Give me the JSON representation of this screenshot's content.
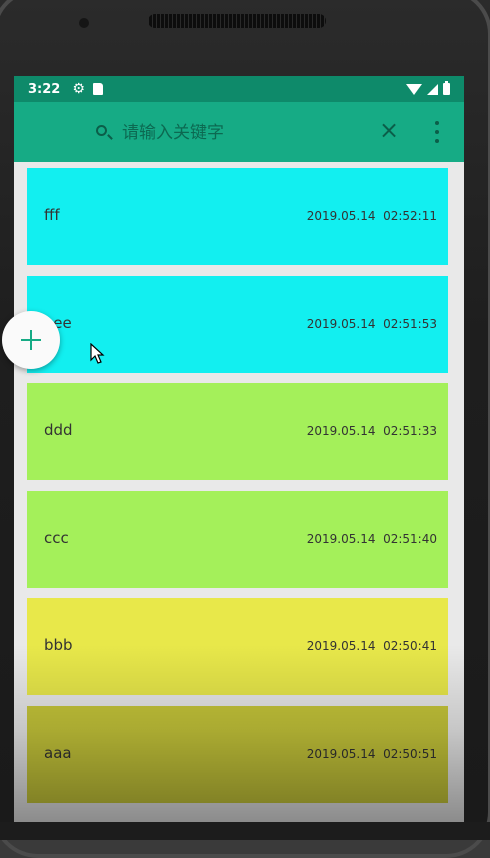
{
  "status_bar": {
    "time": "3:22",
    "icons": [
      "gear-icon",
      "sd-card-icon",
      "wifi-icon",
      "signal-icon",
      "battery-icon"
    ]
  },
  "toolbar": {
    "search_placeholder": "请输入关键字",
    "search_value": "",
    "close_symbol": "×",
    "background": "#16ab85"
  },
  "notes": [
    {
      "title": "fff",
      "time": "2019.05.14  02:52:11",
      "color": "#12eff0"
    },
    {
      "title": "eee",
      "time": "2019.05.14  02:51:53",
      "color": "#12eff0"
    },
    {
      "title": "ddd",
      "time": "2019.05.14  02:51:33",
      "color": "#a4f05a"
    },
    {
      "title": "ccc",
      "time": "2019.05.14  02:51:40",
      "color": "#a4f05a"
    },
    {
      "title": "bbb",
      "time": "2019.05.14  02:50:41",
      "color": "#e8e84a"
    },
    {
      "title": "aaa",
      "time": "2019.05.14  02:50:51",
      "color": "#c8c83a"
    }
  ],
  "fab": {
    "icon": "plus-icon"
  }
}
